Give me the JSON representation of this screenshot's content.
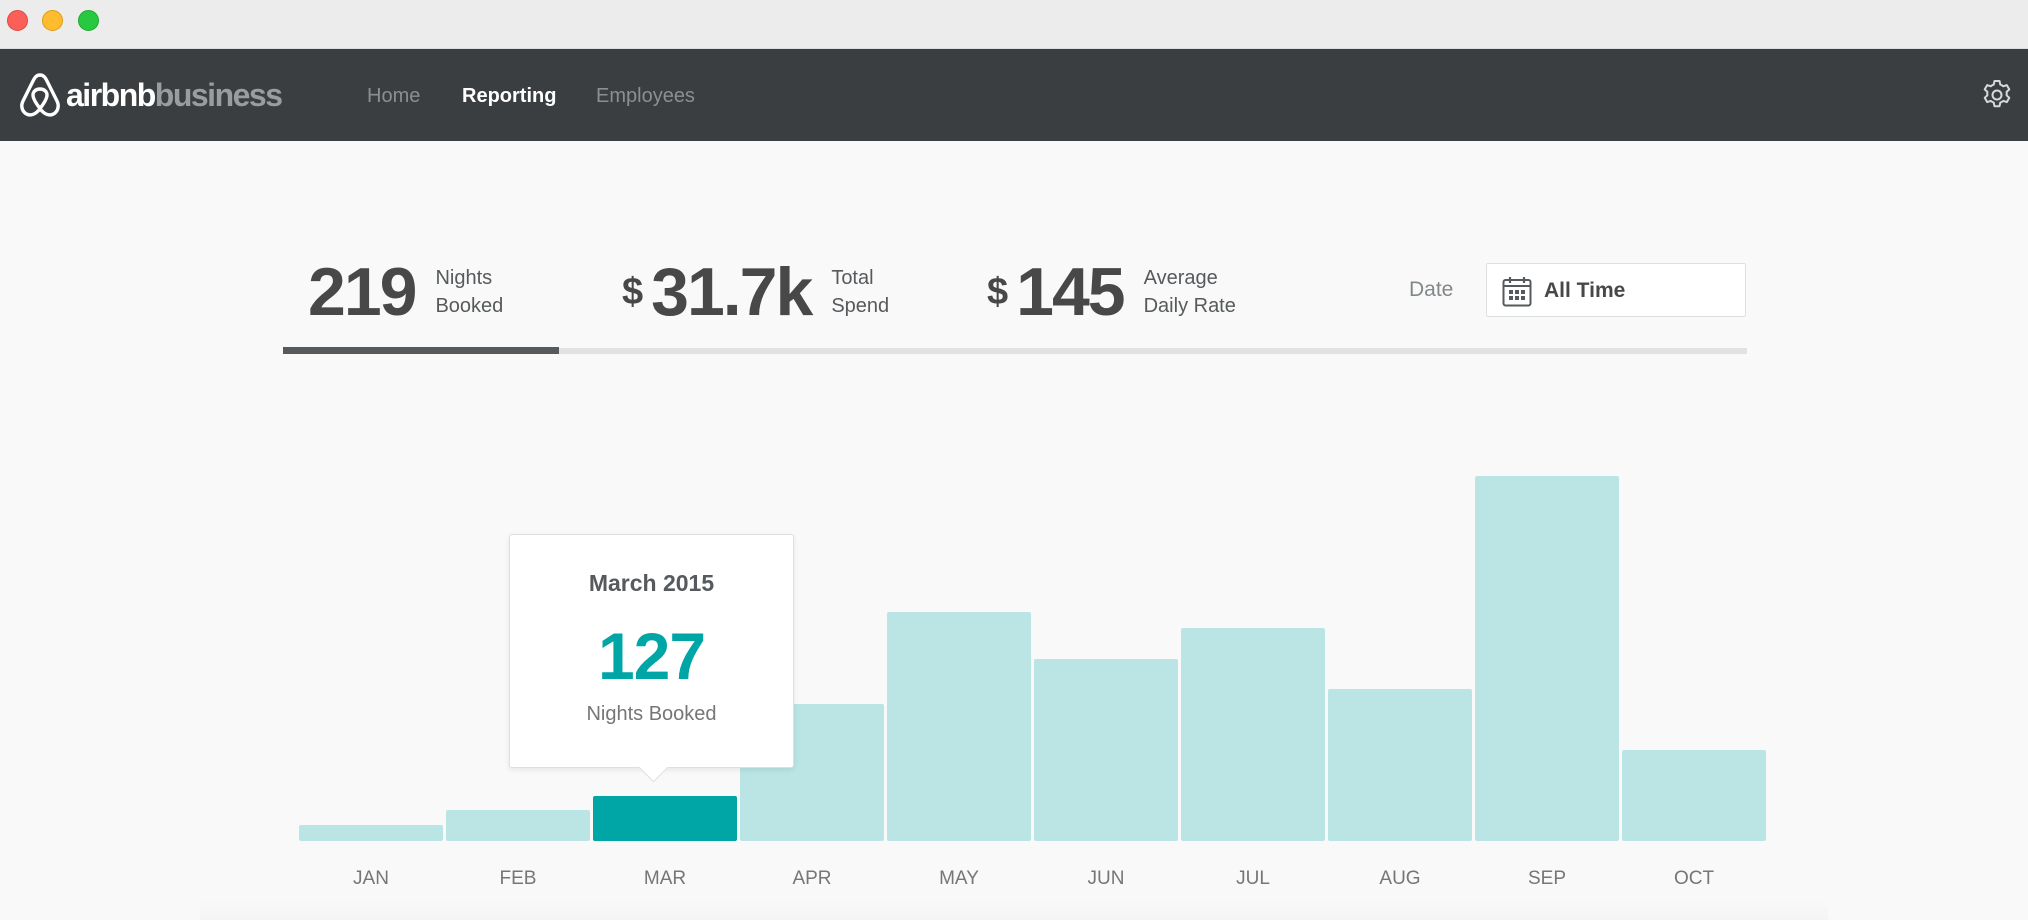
{
  "brand": {
    "name_primary": "airbnb",
    "name_secondary": "business"
  },
  "nav": {
    "items": [
      {
        "label": "Home",
        "active": false
      },
      {
        "label": "Reporting",
        "active": true
      },
      {
        "label": "Employees",
        "active": false
      }
    ],
    "settings_icon": "gear-icon"
  },
  "stats": {
    "nights": {
      "value": "219",
      "label_line1": "Nights",
      "label_line2": "Booked"
    },
    "spend": {
      "currency": "$",
      "value": "31.7k",
      "label_line1": "Total",
      "label_line2": "Spend"
    },
    "rate": {
      "currency": "$",
      "value": "145",
      "label_line1": "Average",
      "label_line2": "Daily Rate"
    }
  },
  "date_filter": {
    "label": "Date",
    "value": "All Time",
    "icon": "calendar-icon"
  },
  "tooltip": {
    "title": "March 2015",
    "value": "127",
    "label": "Nights Booked"
  },
  "colors": {
    "nav_bg": "#3b3e40",
    "bar": "#bbe4e4",
    "bar_selected": "#00a5a6",
    "accent": "#00a5a6"
  },
  "chart_data": {
    "type": "bar",
    "categories": [
      "JAN",
      "FEB",
      "MAR",
      "APR",
      "MAY",
      "JUN",
      "JUL",
      "AUG",
      "SEP",
      "OCT"
    ],
    "values": [
      45,
      88,
      127,
      384,
      640,
      510,
      595,
      425,
      1022,
      255
    ],
    "selected_index": 2,
    "title": "",
    "xlabel": "",
    "ylabel": "",
    "ylim": [
      0,
      1030
    ],
    "grid": false
  }
}
